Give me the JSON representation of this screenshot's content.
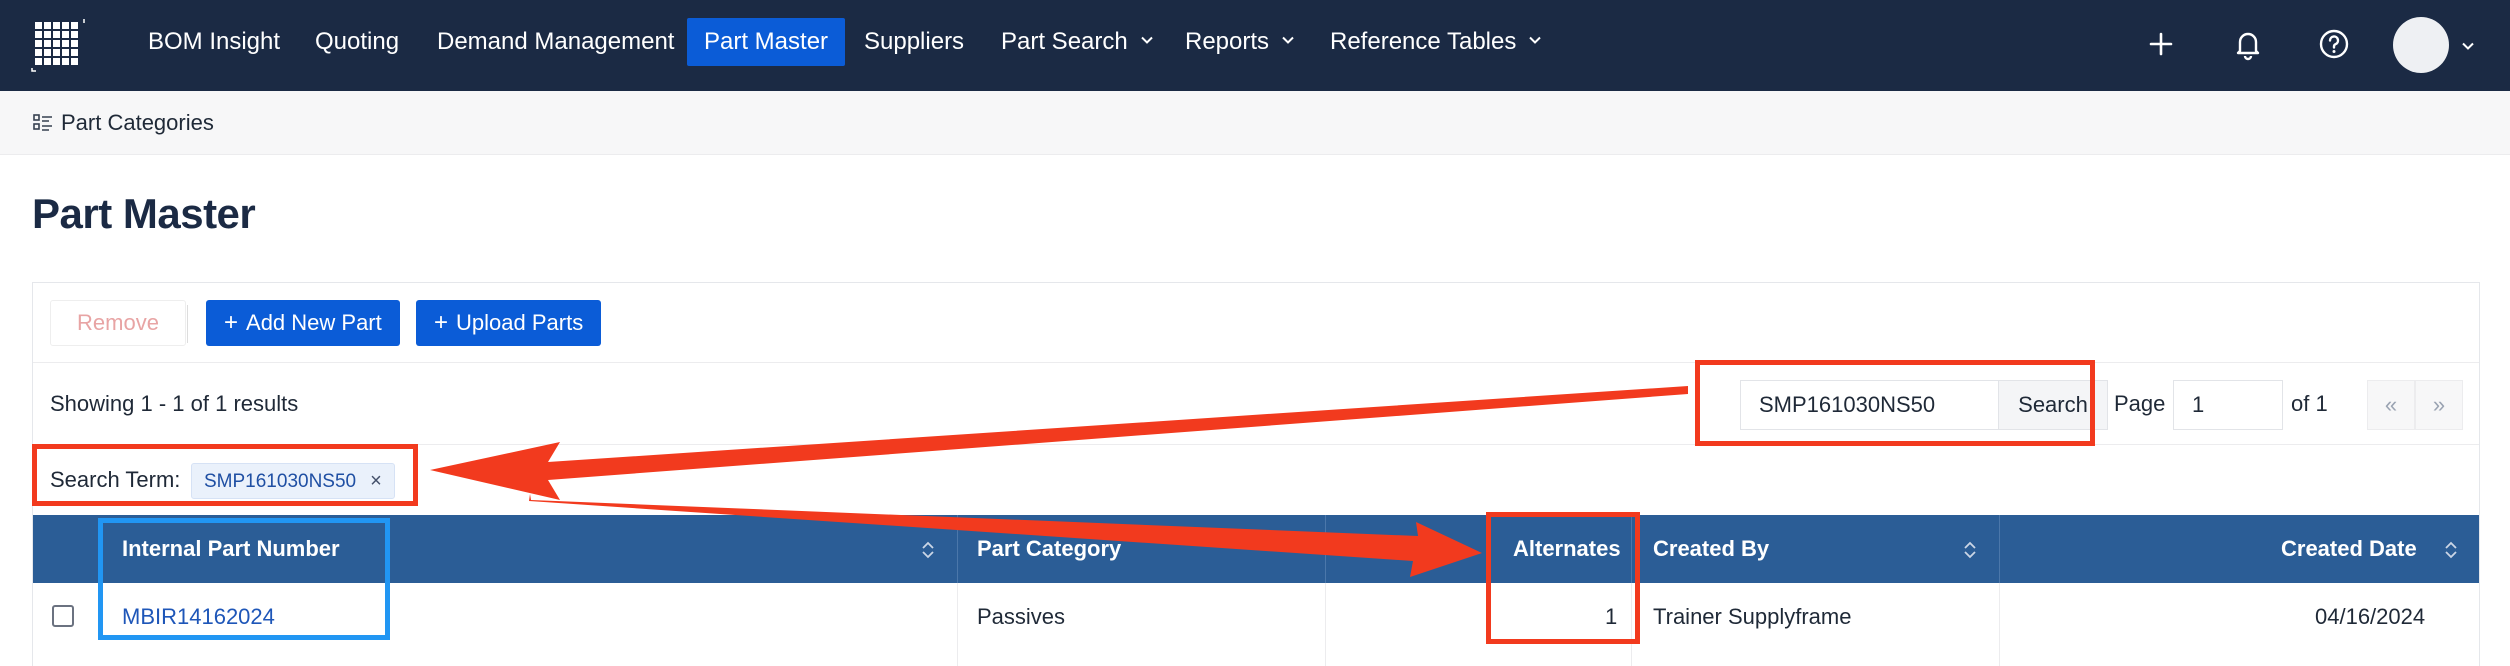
{
  "nav": {
    "items": [
      {
        "label": "BOM Insight"
      },
      {
        "label": "Quoting"
      },
      {
        "label": "Demand Management"
      },
      {
        "label": "Part Master"
      },
      {
        "label": "Suppliers"
      },
      {
        "label": "Part Search"
      },
      {
        "label": "Reports"
      },
      {
        "label": "Reference Tables"
      }
    ],
    "active": "Part Master",
    "icons": [
      "plus-icon",
      "bell-icon",
      "help-icon",
      "avatar",
      "chevron-down-icon"
    ]
  },
  "subheader": {
    "label": "Part Categories",
    "icon": "list-icon"
  },
  "page": {
    "title": "Part Master"
  },
  "toolbar": {
    "remove_label": "Remove",
    "add_label": "Add New Part",
    "upload_label": "Upload Parts"
  },
  "results": {
    "summary": "Showing 1 - 1 of 1 results"
  },
  "search": {
    "value": "SMP161030NS50",
    "button_label": "Search"
  },
  "pagination": {
    "page_label": "Page",
    "current_page": "1",
    "of_label": "of 1",
    "first_label": "«",
    "next_label": "»"
  },
  "filter": {
    "term_label": "Search Term:",
    "term_value": "SMP161030NS50",
    "remove_symbol": "×"
  },
  "table": {
    "columns": [
      "Internal Part Number",
      "Part Category",
      "Alternates",
      "Created By",
      "Created Date"
    ],
    "rows": [
      {
        "part_number": "MBIR14162024",
        "category": "Passives",
        "alternates": "1",
        "created_by": "Trainer Supplyframe",
        "created_date": "04/16/2024"
      }
    ]
  },
  "colors": {
    "nav_bg": "#1b2a44",
    "accent": "#0b5cd7",
    "table_header": "#2b5d96",
    "annotation_red": "#f23a1e",
    "annotation_blue": "#2196f3"
  }
}
